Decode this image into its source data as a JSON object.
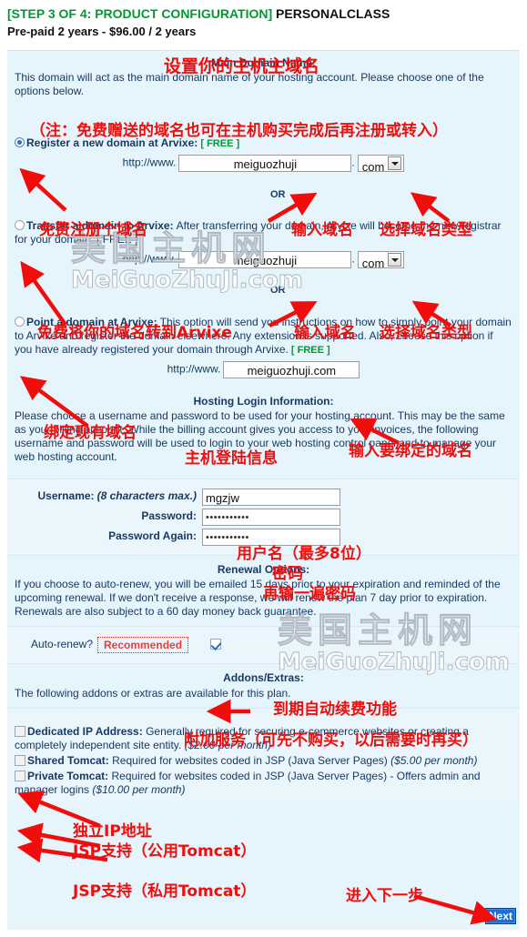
{
  "header": {
    "step_tag": "[STEP 3 OF 4: PRODUCT CONFIGURATION]",
    "plan_name": "PERSONALCLASS",
    "price_line": "Pre-paid 2 years - $96.00 / 2 years"
  },
  "watermark": {
    "line1": "美国主机网",
    "line2": "MeiGuoZhuJi.com"
  },
  "main_domain": {
    "title": "Main Domain Name:",
    "title_cn": "设置你的主机主域名",
    "description": "This domain will act as the main domain name of your hosting account. Please choose one of the options below.",
    "note_cn": "（注：免费赠送的域名也可在主机购买完成后再注册或转入）"
  },
  "option_register": {
    "selected": true,
    "label": "Register a new domain at Arvixe:",
    "free_tag": "[ FREE ]",
    "url_prefix": "http://www.",
    "domain_value": "meiguozhuji",
    "dot": ".",
    "tld_value": "com",
    "annot_radio_cn": "免费注册个域名",
    "annot_input_cn": "输入域名",
    "annot_tld_cn": "选择域名类型",
    "or_label": "OR"
  },
  "option_transfer": {
    "selected": false,
    "label": "Transfer a domain to Arvixe:",
    "description": "After transferring your domain, Arvixe will become the new registrar for your domain. [ FREE ]",
    "url_prefix": "http://www.",
    "domain_value": "meiguozhuji",
    "dot": ".",
    "tld_value": "com",
    "annot_radio_cn": "免费将你的域名转到Arvixe",
    "annot_input_cn": "输入域名",
    "annot_tld_cn": "选择域名类型",
    "or_label": "OR"
  },
  "option_point": {
    "selected": false,
    "label": "Point a domain at Arvixe:",
    "description": "This option will send you instructions on how to simply point your domain to Arvixe and register the domain elsewhere. Any extension is supported. Also, choose this option if you have already registered your domain through Arvixe.",
    "free_tag": "[ FREE ]",
    "url_prefix": "http://www.",
    "domain_value": "meiguozhuji.com",
    "annot_radio_cn": "绑定现有域名",
    "annot_input_cn": "输入要绑定的域名"
  },
  "login_info": {
    "title": "Hosting Login Information:",
    "title_cn": "主机登陆信息",
    "description": "Please choose a username and password to be used for your hosting account. This may be the same as your billing account. While the billing account gives you access to your invoices, the following username and password will be used to login to your web hosting control panel and to manage your web hosting account.",
    "username_label": "Username:",
    "username_hint": "(8 characters max.)",
    "username_value": "mgzjw",
    "username_annot_cn": "用户名（最多8位）",
    "password_label": "Password:",
    "password_value": "•••••••••••",
    "password_annot_cn": "密码",
    "password_again_label": "Password Again:",
    "password_again_value": "•••••••••••",
    "password_again_annot_cn": "再输一遍密码"
  },
  "renewal": {
    "title": "Renewal Options:",
    "description": "If you choose to auto-renew, you will be emailed 15 days prior to your expiration and reminded of the upcoming renewal. If we don't receive a response, we will renew the plan 7 day prior to expiration. Renewals are also subject to a 60 day money back guarantee.",
    "auto_renew_label": "Auto-renew?",
    "recommended_badge": "Recommended",
    "auto_renew_checked": true,
    "annot_cn": "到期自动续费功能"
  },
  "addons": {
    "title": "Addons/Extras:",
    "title_cn": "附加服务（可先不购买，以后需要时再买）",
    "description": "The following addons or extras are available for this plan.",
    "items": [
      {
        "checked": false,
        "label": "Dedicated IP Address:",
        "description": "Generally required for securing e-commerce websites or creating a completely independent site entity.",
        "price": "($2.00 per month)",
        "annot_cn": "独立IP地址"
      },
      {
        "checked": false,
        "label": "Shared Tomcat:",
        "description": "Required for websites coded in JSP (Java Server Pages)",
        "price": "($5.00 per month)",
        "annot_cn": "JSP支持（公用Tomcat）"
      },
      {
        "checked": false,
        "label": "Private Tomcat:",
        "description": "Required for websites coded in JSP (Java Server Pages) - Offers admin and manager logins",
        "price": "($10.00 per month)",
        "annot_cn": "JSP支持（私用Tomcat）"
      }
    ]
  },
  "footer": {
    "next_label": "Next",
    "annot_cn": "进入下一步"
  },
  "colors": {
    "panel_bg": "#e6f4fb",
    "annotation_red": "#f20d0d",
    "free_green": "#009933",
    "text_blue": "#173a63",
    "next_blue": "#1b6fd6"
  }
}
